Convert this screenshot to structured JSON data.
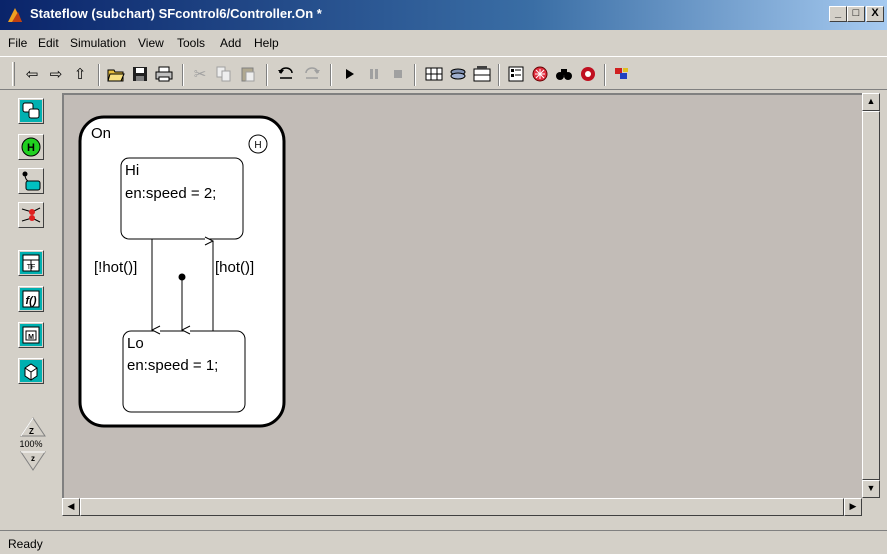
{
  "window": {
    "title": "Stateflow (subchart) SFcontrol6/Controller.On *",
    "minimize": "_",
    "maximize": "□",
    "close": "X"
  },
  "menu": [
    "File",
    "Edit",
    "Simulation",
    "View",
    "Tools",
    "Add",
    "Help"
  ],
  "toolbar": {
    "icons": [
      "back-icon",
      "forward-icon",
      "up-icon",
      "open-icon",
      "save-icon",
      "print-icon",
      "cut-icon",
      "copy-icon",
      "paste-icon",
      "undo-icon",
      "redo-icon",
      "start-icon",
      "pause-icon",
      "stop-icon",
      "build-icon",
      "debug-icon",
      "rebuild-icon",
      "explorer-icon",
      "parse-icon",
      "find-icon",
      "target-icon",
      "library-icon"
    ]
  },
  "palette": {
    "tools": [
      "state-tool-icon",
      "history-junction-tool-icon",
      "default-transition-tool-icon",
      "connective-junction-tool-icon",
      "truth-table-tool-icon",
      "function-tool-icon",
      "embedded-matlab-tool-icon",
      "box-tool-icon"
    ],
    "zoom": "100%",
    "zoom_in": "Z",
    "zoom_out": "z"
  },
  "chart": {
    "superstate": "On",
    "history_junction": "H",
    "states": [
      {
        "name": "Hi",
        "action": "en:speed = 2;"
      },
      {
        "name": "Lo",
        "action": "en:speed = 1;"
      }
    ],
    "transitions": [
      {
        "label": "[!hot()]",
        "from": "Hi",
        "to": "Lo"
      },
      {
        "label": "[hot()]",
        "from": "Lo",
        "to": "Hi"
      }
    ]
  },
  "status": "Ready",
  "colors": {
    "titlebar_start": "#0a246a",
    "titlebar_end": "#a6caf0",
    "canvas": "#c2bcb7",
    "chart_bg": "#ffffff"
  }
}
